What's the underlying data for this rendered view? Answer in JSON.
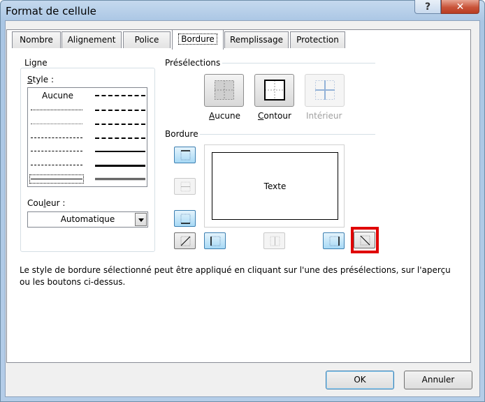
{
  "window": {
    "title": "Format de cellule",
    "help_label": "?",
    "close_label": "✕"
  },
  "tabs": [
    {
      "label": "Nombre",
      "active": false
    },
    {
      "label": "Alignement",
      "active": false
    },
    {
      "label": "Police",
      "active": false
    },
    {
      "label": "Bordure",
      "active": true
    },
    {
      "label": "Remplissage",
      "active": false
    },
    {
      "label": "Protection",
      "active": false
    }
  ],
  "ligne": {
    "group_label": "Ligne",
    "style_label": "Style :",
    "style_none": "Aucune",
    "color_label": "Couleur :",
    "color_value": "Automatique"
  },
  "presets": {
    "group_label": "Présélections",
    "items": [
      {
        "label": "Aucune",
        "icon": "preset-none-icon",
        "enabled": true
      },
      {
        "label": "Contour",
        "icon": "preset-outline-icon",
        "enabled": true
      },
      {
        "label": "Intérieur",
        "icon": "preset-inside-icon",
        "enabled": false
      }
    ]
  },
  "border": {
    "group_label": "Bordure",
    "preview_text": "Texte"
  },
  "hint": "Le style de bordure sélectionné peut être appliqué en cliquant sur l'une des présélections, sur l'aperçu ou les boutons ci-dessus.",
  "buttons": {
    "ok": "OK",
    "cancel": "Annuler"
  },
  "colors": {
    "highlight": "#e00000",
    "active_toggle": "#a7d9f5"
  }
}
